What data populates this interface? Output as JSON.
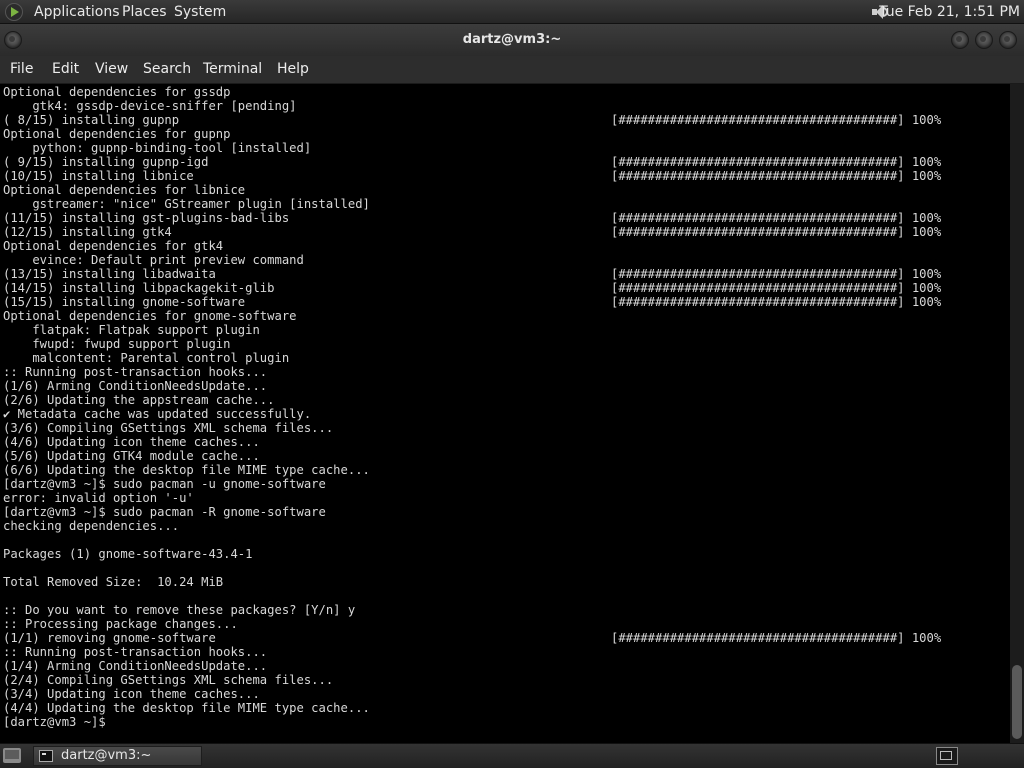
{
  "top_panel": {
    "menus": [
      "Applications",
      "Places",
      "System"
    ],
    "clock": "Tue Feb 21,  1:51 PM",
    "icons": [
      "distro-logo-icon",
      "volume-icon"
    ]
  },
  "window": {
    "title": "dartz@vm3:~",
    "menu": [
      "File",
      "Edit",
      "View",
      "Search",
      "Terminal",
      "Help"
    ]
  },
  "terminal": {
    "lines": [
      {
        "text": "Optional dependencies for gssdp"
      },
      {
        "text": "    gtk4: gssdp-device-sniffer [pending]"
      },
      {
        "text": "( 8/15) installing gupnp",
        "progress": "[######################################] 100%"
      },
      {
        "text": "Optional dependencies for gupnp"
      },
      {
        "text": "    python: gupnp-binding-tool [installed]"
      },
      {
        "text": "( 9/15) installing gupnp-igd",
        "progress": "[######################################] 100%"
      },
      {
        "text": "(10/15) installing libnice",
        "progress": "[######################################] 100%"
      },
      {
        "text": "Optional dependencies for libnice"
      },
      {
        "text": "    gstreamer: \"nice\" GStreamer plugin [installed]"
      },
      {
        "text": "(11/15) installing gst-plugins-bad-libs",
        "progress": "[######################################] 100%"
      },
      {
        "text": "(12/15) installing gtk4",
        "progress": "[######################################] 100%"
      },
      {
        "text": "Optional dependencies for gtk4"
      },
      {
        "text": "    evince: Default print preview command"
      },
      {
        "text": "(13/15) installing libadwaita",
        "progress": "[######################################] 100%"
      },
      {
        "text": "(14/15) installing libpackagekit-glib",
        "progress": "[######################################] 100%"
      },
      {
        "text": "(15/15) installing gnome-software",
        "progress": "[######################################] 100%"
      },
      {
        "text": "Optional dependencies for gnome-software"
      },
      {
        "text": "    flatpak: Flatpak support plugin"
      },
      {
        "text": "    fwupd: fwupd support plugin"
      },
      {
        "text": "    malcontent: Parental control plugin"
      },
      {
        "text": ":: Running post-transaction hooks..."
      },
      {
        "text": "(1/6) Arming ConditionNeedsUpdate..."
      },
      {
        "text": "(2/6) Updating the appstream cache..."
      },
      {
        "text": "✔ Metadata cache was updated successfully."
      },
      {
        "text": "(3/6) Compiling GSettings XML schema files..."
      },
      {
        "text": "(4/6) Updating icon theme caches..."
      },
      {
        "text": "(5/6) Updating GTK4 module cache..."
      },
      {
        "text": "(6/6) Updating the desktop file MIME type cache..."
      },
      {
        "text": "[dartz@vm3 ~]$ sudo pacman -u gnome-software"
      },
      {
        "text": "error: invalid option '-u'"
      },
      {
        "text": "[dartz@vm3 ~]$ sudo pacman -R gnome-software"
      },
      {
        "text": "checking dependencies..."
      },
      {
        "text": ""
      },
      {
        "text": "Packages (1) gnome-software-43.4-1"
      },
      {
        "text": ""
      },
      {
        "text": "Total Removed Size:  10.24 MiB"
      },
      {
        "text": ""
      },
      {
        "text": ":: Do you want to remove these packages? [Y/n] y"
      },
      {
        "text": ":: Processing package changes..."
      },
      {
        "text": "(1/1) removing gnome-software",
        "progress": "[######################################] 100%"
      },
      {
        "text": ":: Running post-transaction hooks..."
      },
      {
        "text": "(1/4) Arming ConditionNeedsUpdate..."
      },
      {
        "text": "(2/4) Compiling GSettings XML schema files..."
      },
      {
        "text": "(3/4) Updating icon theme caches..."
      },
      {
        "text": "(4/4) Updating the desktop file MIME type cache..."
      },
      {
        "text": "[dartz@vm3 ~]$"
      }
    ]
  },
  "taskbar": {
    "task_label": "dartz@vm3:~"
  }
}
